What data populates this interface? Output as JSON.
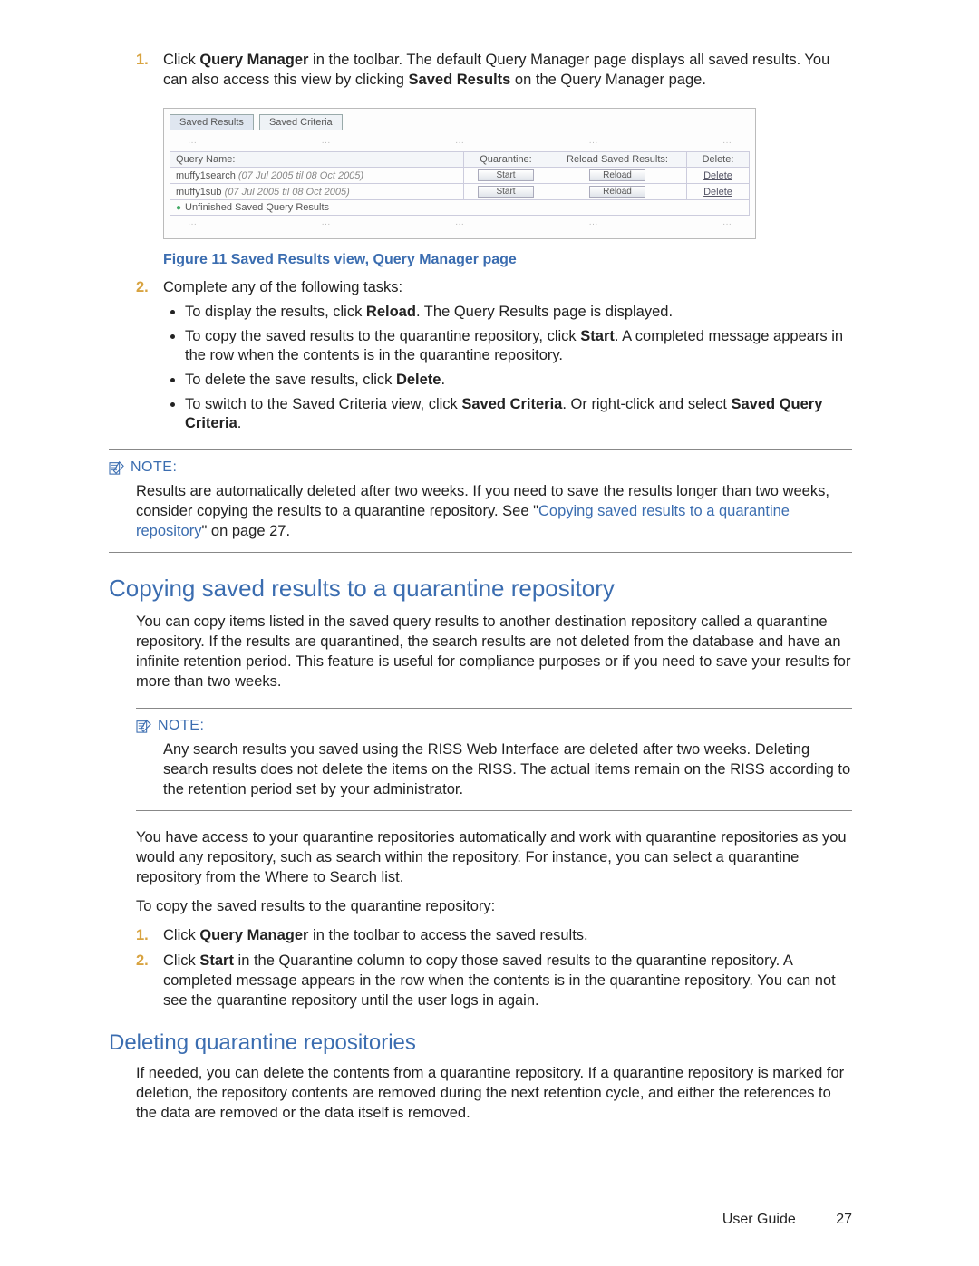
{
  "step1": {
    "num": "1.",
    "text_pre": "Click ",
    "bold1": "Query Manager",
    "text_mid": " in the toolbar. The default Query Manager page displays all saved results. You can also access this view by clicking ",
    "bold2": "Saved Results",
    "text_end": " on the Query Manager page."
  },
  "figure": {
    "tab_active": "Saved Results",
    "tab_other": "Saved Criteria",
    "headers": {
      "name": "Query Name:",
      "quarantine": "Quarantine:",
      "reload": "Reload Saved Results:",
      "delete": "Delete:"
    },
    "rows": [
      {
        "name": "muffy1search",
        "date": "(07 Jul 2005 til 08 Oct 2005)",
        "btn_q": "Start",
        "btn_r": "Reload",
        "btn_d": "Delete"
      },
      {
        "name": "muffy1sub",
        "date": "(07 Jul 2005 til 08 Oct 2005)",
        "btn_q": "Start",
        "btn_r": "Reload",
        "btn_d": "Delete"
      }
    ],
    "footerrow": "Unfinished Saved Query Results",
    "caption": "Figure 11 Saved Results view, Query Manager page"
  },
  "step2": {
    "num": "2.",
    "lead": "Complete any of the following tasks:",
    "b1_pre": "To display the results, click ",
    "b1_bold": "Reload",
    "b1_post": ". The Query Results page is displayed.",
    "b2_pre": "To copy the saved results to the quarantine repository, click ",
    "b2_bold": "Start",
    "b2_post": ". A completed message appears in the row when the contents is in the quarantine repository.",
    "b3_pre": "To delete the save results, click ",
    "b3_bold": "Delete",
    "b3_post": ".",
    "b4_pre": "To switch to the Saved Criteria view, click ",
    "b4_bold": "Saved Criteria",
    "b4_mid": ". Or right-click and select ",
    "b4_bold2": "Saved Query Criteria",
    "b4_post": "."
  },
  "note1": {
    "label": "NOTE:",
    "t1": "Results are automatically deleted after two weeks. If you need to save the results longer than two weeks, consider copying the results to a quarantine repository. See \"",
    "link": "Copying saved results to a quarantine repository",
    "t2": "\" on page 27."
  },
  "sec1": {
    "heading": "Copying saved results to a quarantine repository",
    "p1": "You can copy items listed in the saved query results to another destination repository called a quarantine repository. If the results are quarantined, the search results are not deleted from the database and have an infinite retention period. This feature is useful for compliance purposes or if you need to save your results for more than two weeks."
  },
  "note2": {
    "label": "NOTE:",
    "t": "Any search results you saved using the RISS Web Interface are deleted after two weeks. Deleting search results does not delete the items on the RISS. The actual items remain on the RISS according to the retention period set by your administrator."
  },
  "sec1b": {
    "p2": "You have access to your quarantine repositories automatically and work with quarantine repositories as you would any repository, such as search within the repository. For instance, you can select a quarantine repository from the Where to Search list.",
    "p3": "To copy the saved results to the quarantine repository:",
    "s1num": "1.",
    "s1_pre": "Click ",
    "s1_bold": "Query Manager",
    "s1_post": " in the toolbar to access the saved results.",
    "s2num": "2.",
    "s2_pre": "Click ",
    "s2_bold": "Start",
    "s2_post": " in the Quarantine column to copy those saved results to the quarantine repository. A completed message appears in the row when the contents is in the quarantine repository. You can not see the quarantine repository until the user logs in again."
  },
  "sec2": {
    "heading": "Deleting quarantine repositories",
    "p1": "If needed, you can delete the contents from a quarantine repository. If a quarantine repository is marked for deletion, the repository contents are removed during the next retention cycle, and either the references to the data are removed or the data itself is removed."
  },
  "footer": {
    "label": "User Guide",
    "page": "27"
  }
}
